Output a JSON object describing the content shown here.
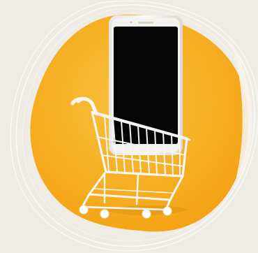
{
  "image": {
    "subject": "shopping-cart-with-smartphone",
    "icon_names": [
      "smartphone-icon",
      "shopping-cart-icon"
    ],
    "colors": {
      "page_background": "#efece6",
      "blob_orange": "#f6ad1a",
      "blob_orange_light": "#f9c13d",
      "outline_rings": "#ffffff",
      "phone_body": "#f4f2ee",
      "phone_screen": "#050505",
      "cart_wire": "#f7f5f1",
      "cart_shadow": "#d88f10",
      "wheel": "#ffffff"
    }
  }
}
